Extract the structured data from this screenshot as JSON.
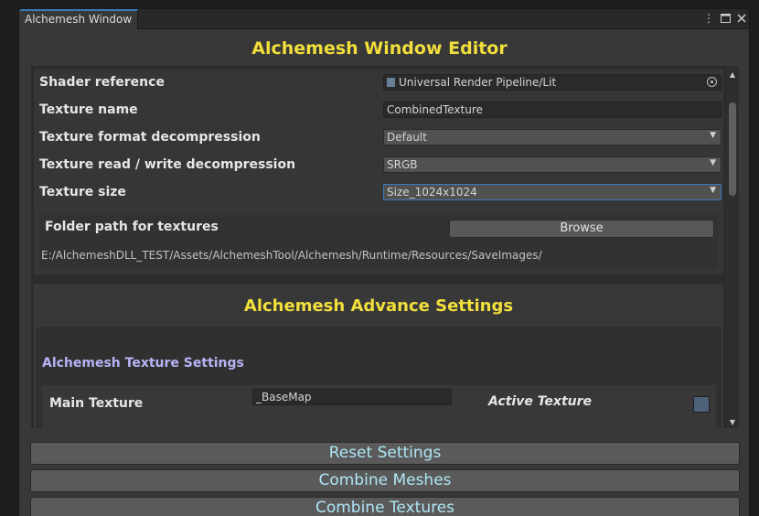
{
  "window": {
    "tab_title": "Alchemesh Window",
    "tab_icons": [
      "more-vert-icon",
      "maximize-icon",
      "close-icon"
    ]
  },
  "header": {
    "title": "Alchemesh Window Editor"
  },
  "properties": {
    "shader": {
      "label": "Shader reference",
      "value": "Universal Render Pipeline/Lit"
    },
    "texture_name": {
      "label": "Texture name",
      "value": "CombinedTexture"
    },
    "format_decompression": {
      "label": "Texture format decompression",
      "value": "Default"
    },
    "rw_decompression": {
      "label": "Texture read / write decompression",
      "value": "SRGB"
    },
    "texture_size": {
      "label": "Texture size",
      "value": "Size_1024x1024"
    },
    "folder": {
      "label": "Folder path for textures",
      "browse_label": "Browse",
      "path": "E:/AlchemeshDLL_TEST/Assets/AlchemeshTool/Alchemesh/Runtime/Resources/SaveImages/"
    }
  },
  "advanced": {
    "title": "Alchemesh Advance Settings",
    "texture_settings_title": "Alchemesh Texture Settings",
    "main_texture": {
      "label": "Main Texture",
      "value": "_BaseMap",
      "active_label": "Active Texture",
      "active": false
    }
  },
  "buttons": {
    "reset": "Reset Settings",
    "combine_meshes": "Combine Meshes",
    "combine_textures": "Combine Textures"
  },
  "colors": {
    "title": "#f2df3c",
    "subtitle": "#b7b3f4",
    "button_text": "#aee6f5",
    "focus": "#3a79bb"
  }
}
